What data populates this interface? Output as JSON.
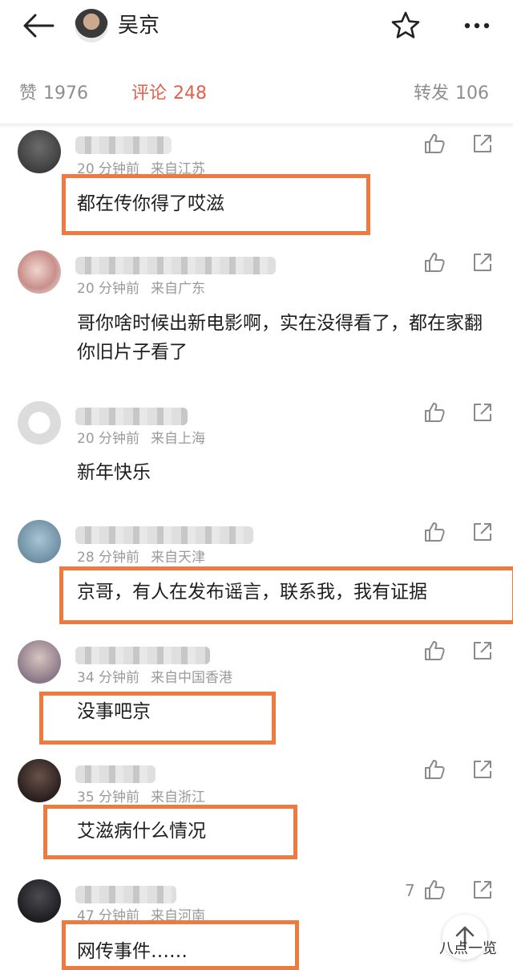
{
  "header": {
    "title": "吴京"
  },
  "tabs": {
    "like": {
      "label": "赞",
      "count": "1976"
    },
    "comments": {
      "label": "评论",
      "count": "248"
    },
    "repost": {
      "label": "转发",
      "count": "106"
    }
  },
  "comments": [
    {
      "time": "20 分钟前",
      "location": "来自江苏",
      "text": "都在传你得了哎滋"
    },
    {
      "time": "20 分钟前",
      "location": "来自广东",
      "text": "哥你啥时候出新电影啊，实在没得看了，都在家翻你旧片子看了"
    },
    {
      "time": "20 分钟前",
      "location": "来自上海",
      "text": "新年快乐"
    },
    {
      "time": "28 分钟前",
      "location": "来自天津",
      "text": "京哥，有人在发布谣言，联系我，我有证据"
    },
    {
      "time": "34 分钟前",
      "location": "来自中国香港",
      "text": "没事吧京"
    },
    {
      "time": "35 分钟前",
      "location": "来自浙江",
      "text": "艾滋病什么情况"
    },
    {
      "time": "47 分钟前",
      "location": "来自河南",
      "text": "网传事件……",
      "likes": "7"
    }
  ],
  "watermark": "八点一览",
  "colors": {
    "accent": "#e0614b",
    "highlight_box": "#ee7a3f",
    "meta": "#9a9a9a"
  },
  "icons": [
    "back-arrow-icon",
    "star-icon",
    "more-icon",
    "thumb-up-icon",
    "share-icon",
    "arrow-up-icon"
  ]
}
